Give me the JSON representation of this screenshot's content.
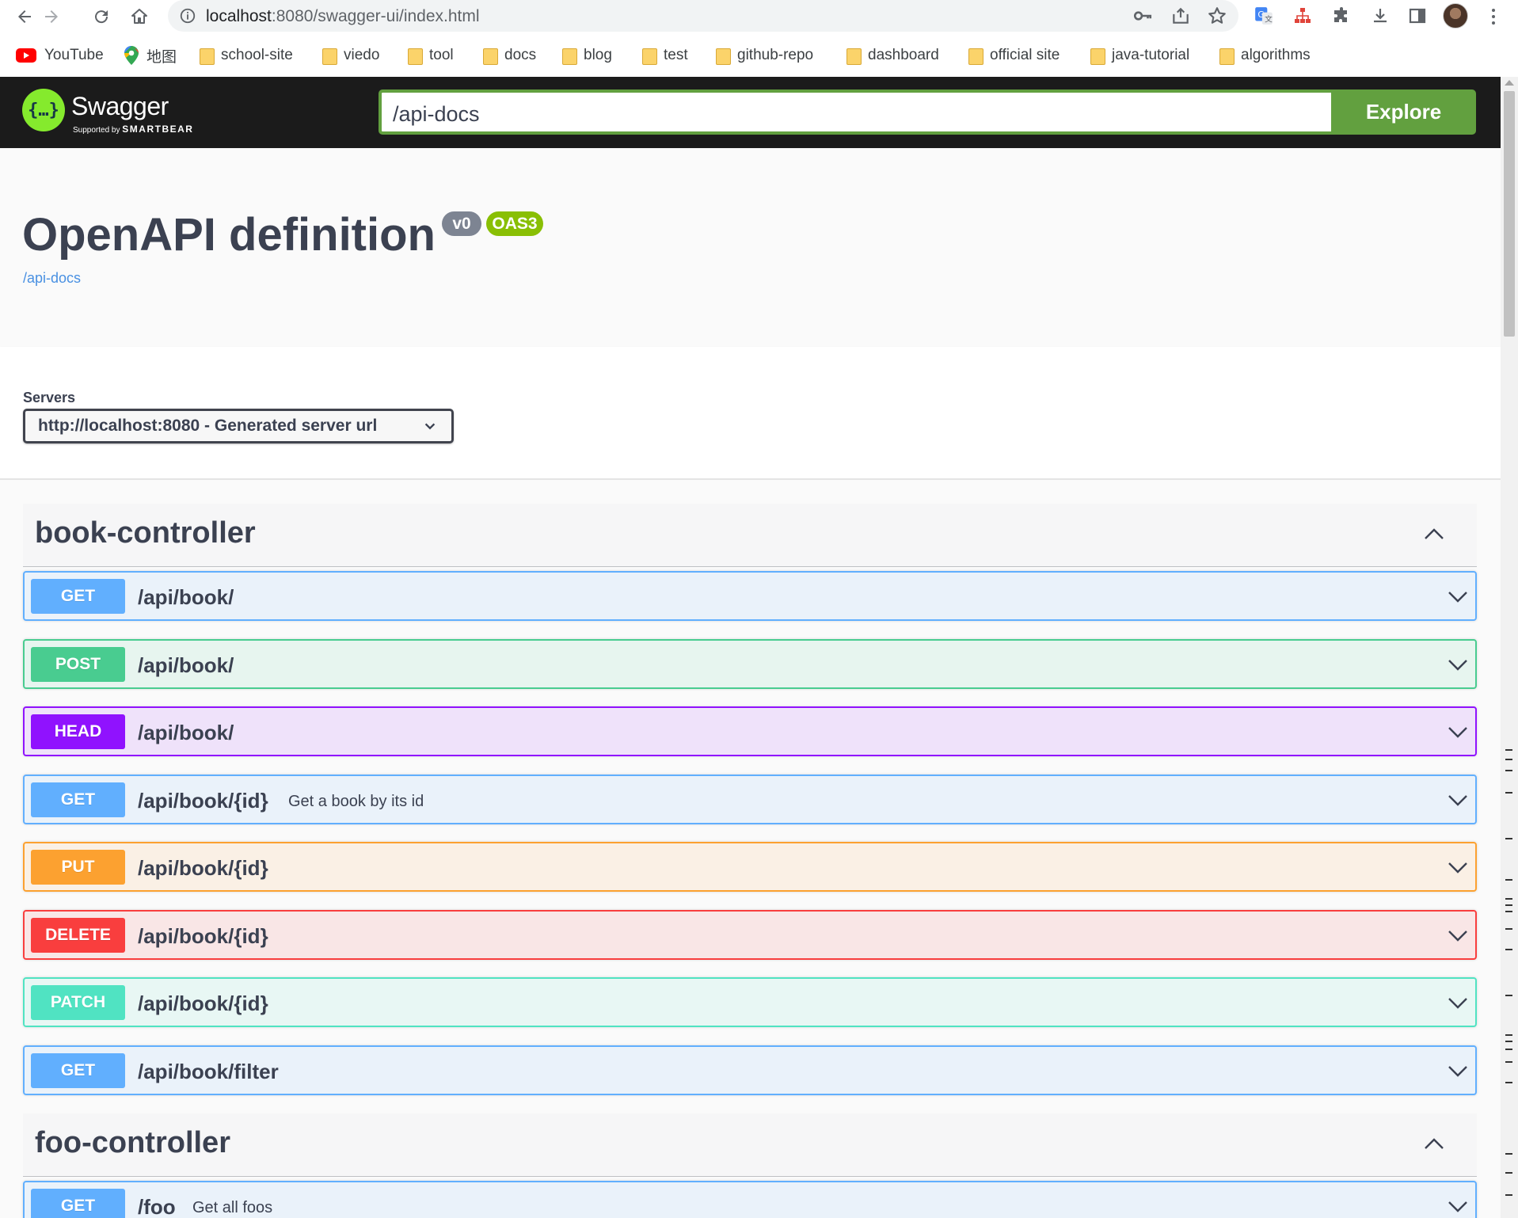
{
  "browser": {
    "url_host": "localhost",
    "url_rest": ":8080/swagger-ui/index.html",
    "bookmarks": [
      {
        "label": "YouTube",
        "icon": "youtube-icon"
      },
      {
        "label": "地图",
        "icon": "maps-icon"
      },
      {
        "label": "school-site",
        "icon": "folder-icon"
      },
      {
        "label": "viedo",
        "icon": "folder-icon"
      },
      {
        "label": "tool",
        "icon": "folder-icon"
      },
      {
        "label": "docs",
        "icon": "folder-icon"
      },
      {
        "label": "blog",
        "icon": "folder-icon"
      },
      {
        "label": "test",
        "icon": "folder-icon"
      },
      {
        "label": "github-repo",
        "icon": "folder-icon"
      },
      {
        "label": "dashboard",
        "icon": "folder-icon"
      },
      {
        "label": "official site",
        "icon": "folder-icon"
      },
      {
        "label": "java-tutorial",
        "icon": "folder-icon"
      },
      {
        "label": "algorithms",
        "icon": "folder-icon"
      }
    ]
  },
  "topbar": {
    "logo_title": "Swagger",
    "logo_sub_prefix": "Supported by",
    "logo_sub_brand": "SMARTBEAR",
    "spec_url": "/api-docs",
    "explore_label": "Explore"
  },
  "info": {
    "title": "OpenAPI definition",
    "version_badge": "v0",
    "oas_badge": "OAS3",
    "spec_link": "/api-docs"
  },
  "servers": {
    "label": "Servers",
    "selected": "http://localhost:8080 - Generated server url"
  },
  "tags": [
    {
      "name": "book-controller",
      "operations": [
        {
          "method": "GET",
          "path": "/api/book/",
          "summary": ""
        },
        {
          "method": "POST",
          "path": "/api/book/",
          "summary": ""
        },
        {
          "method": "HEAD",
          "path": "/api/book/",
          "summary": ""
        },
        {
          "method": "GET",
          "path": "/api/book/{id}",
          "summary": "Get a book by its id"
        },
        {
          "method": "PUT",
          "path": "/api/book/{id}",
          "summary": ""
        },
        {
          "method": "DELETE",
          "path": "/api/book/{id}",
          "summary": ""
        },
        {
          "method": "PATCH",
          "path": "/api/book/{id}",
          "summary": ""
        },
        {
          "method": "GET",
          "path": "/api/book/filter",
          "summary": ""
        }
      ]
    },
    {
      "name": "foo-controller",
      "operations": [
        {
          "method": "GET",
          "path": "/foo",
          "summary": "Get all foos"
        }
      ]
    }
  ],
  "colors": {
    "get": "#61affe",
    "post": "#49cc90",
    "head": "#9012fe",
    "put": "#fca130",
    "delete": "#f93e3e",
    "patch": "#50e3c2",
    "explore": "#62a03f",
    "topbar": "#1b1b1b"
  }
}
